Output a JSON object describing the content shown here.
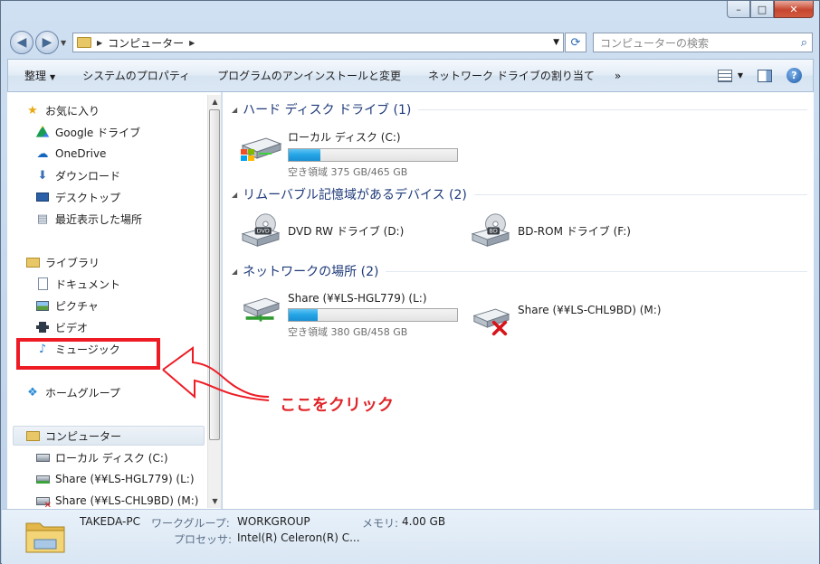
{
  "window": {
    "caption": {
      "minimize": "–",
      "maximize": "□",
      "close": "✕"
    }
  },
  "address_bar": {
    "crumbs": [
      "コンピューター"
    ],
    "search_placeholder": "コンピューターの検索"
  },
  "toolbar": {
    "items": [
      "整理",
      "システムのプロパティ",
      "プログラムのアンインストールと変更",
      "ネットワーク ドライブの割り当て"
    ],
    "more": "»"
  },
  "nav_pane": {
    "favorites": {
      "label": "お気に入り",
      "items": [
        "Google ドライブ",
        "OneDrive",
        "ダウンロード",
        "デスクトップ",
        "最近表示した場所"
      ]
    },
    "libraries": {
      "label": "ライブラリ",
      "items": [
        "ドキュメント",
        "ピクチャ",
        "ビデオ",
        "ミュージック"
      ]
    },
    "homegroup": {
      "label": "ホームグループ"
    },
    "computer": {
      "label": "コンピューター",
      "items": [
        "ローカル ディスク (C:)",
        "Share (¥¥LS-HGL779) (L:)",
        "Share (¥¥LS-CHL9BD) (M:)"
      ]
    }
  },
  "content": {
    "groups": [
      {
        "title": "ハード ディスク ドライブ (1)"
      },
      {
        "title": "リムーバブル記憶域があるデバイス (2)"
      },
      {
        "title": "ネットワークの場所 (2)"
      }
    ],
    "drives": {
      "c": {
        "name": "ローカル ディスク (C:)",
        "free": "空き領域 375 GB/465 GB",
        "used_fraction": 0.19
      },
      "d": {
        "name": "DVD RW ドライブ (D:)",
        "badge": "DVD"
      },
      "f": {
        "name": "BD-ROM ドライブ (F:)",
        "badge": "BD"
      },
      "l": {
        "name": "Share (¥¥LS-HGL779) (L:)",
        "free": "空き領域 380 GB/458 GB",
        "used_fraction": 0.17
      },
      "m": {
        "name": "Share (¥¥LS-CHL9BD) (M:)"
      }
    }
  },
  "details": {
    "computer_name": "TAKEDA-PC",
    "workgroup_label": "ワークグループ:",
    "workgroup_value": "WORKGROUP",
    "memory_label": "メモリ:",
    "memory_value": "4.00 GB",
    "processor_label": "プロセッサ:",
    "processor_value": "Intel(R) Celeron(R) C..."
  },
  "annotation": {
    "text": "ここをクリック",
    "color": "#ee1b24"
  }
}
